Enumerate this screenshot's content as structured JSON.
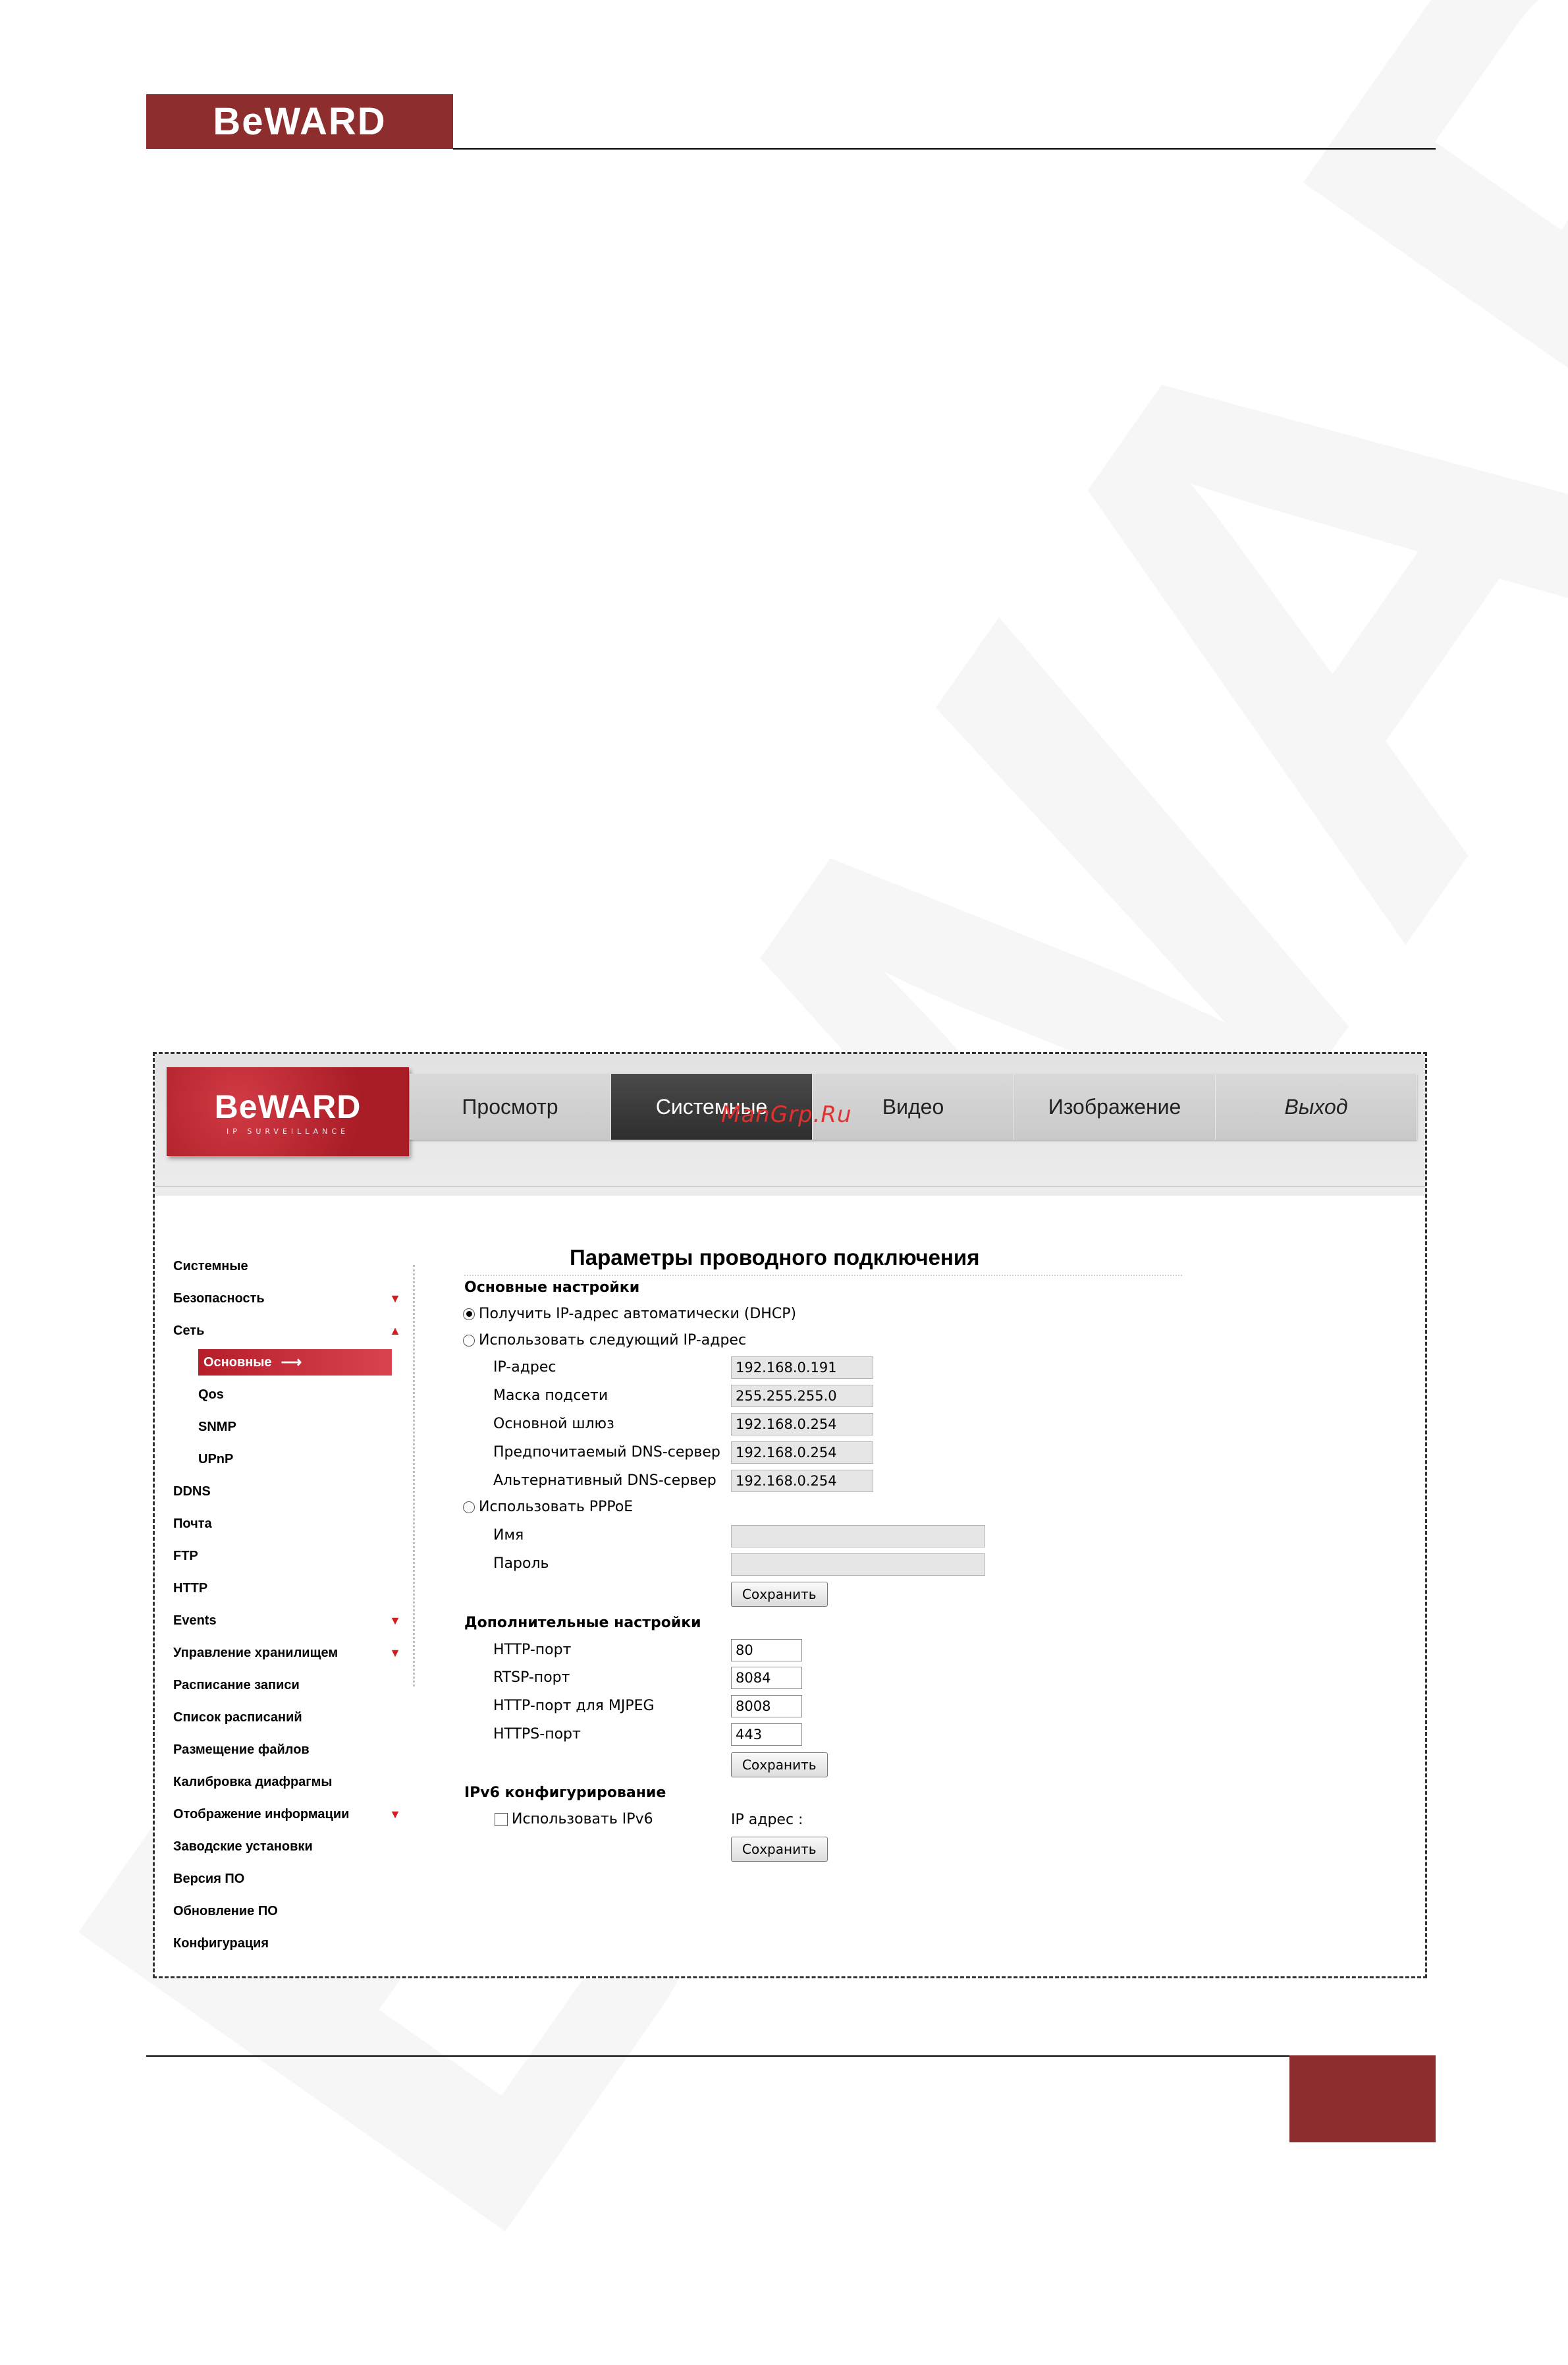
{
  "doc": {
    "logo_text": "BeWARD"
  },
  "camera_ui": {
    "logo_brand": "BeWARD",
    "logo_sub": "IP SURVEILLANCE",
    "overlay_watermark": "ManGrp.Ru",
    "nav": {
      "tabs": [
        "Просмотр",
        "Системные",
        "Видео",
        "Изображение",
        "Выход"
      ],
      "active_index": 1
    },
    "sidebar": {
      "items": [
        {
          "label": "Системные"
        },
        {
          "label": "Безопасность"
        },
        {
          "label": "Сеть"
        },
        {
          "label": "Основные"
        },
        {
          "label": "Qos"
        },
        {
          "label": "SNMP"
        },
        {
          "label": "UPnP"
        },
        {
          "label": "DDNS"
        },
        {
          "label": "Почта"
        },
        {
          "label": "FTP"
        },
        {
          "label": "HTTP"
        },
        {
          "label": "Events"
        },
        {
          "label": "Управление хранилищем"
        },
        {
          "label": "Расписание записи"
        },
        {
          "label": "Список расписаний"
        },
        {
          "label": "Размещение файлов"
        },
        {
          "label": "Калибровка диафрагмы"
        },
        {
          "label": "Отображение информации"
        },
        {
          "label": "Заводские установки"
        },
        {
          "label": "Версия ПО"
        },
        {
          "label": "Обновление ПО"
        },
        {
          "label": "Конфигурация"
        }
      ],
      "active_item": "Основные"
    },
    "content": {
      "title": "Параметры проводного подключения",
      "basic": {
        "heading": "Основные настройки",
        "dhcp_label": "Получить IP-адрес автоматически (DHCP)",
        "dhcp_selected": true,
        "static_label": "Использовать следующий IP-адрес",
        "ip_label": "IP-адрес",
        "ip_value": "192.168.0.191",
        "mask_label": "Маска подсети",
        "mask_value": "255.255.255.0",
        "gateway_label": "Основной шлюз",
        "gateway_value": "192.168.0.254",
        "dns1_label": "Предпочитаемый DNS-сервер",
        "dns1_value": "192.168.0.254",
        "dns2_label": "Альтернативный DNS-сервер",
        "dns2_value": "192.168.0.254",
        "pppoe_label": "Использовать PPPoE",
        "name_label": "Имя",
        "name_value": "",
        "password_label": "Пароль",
        "password_value": "",
        "save_label": "Сохранить"
      },
      "advanced": {
        "heading": "Дополнительные настройки",
        "http_label": "HTTP-порт",
        "http_value": "80",
        "rtsp_label": "RTSP-порт",
        "rtsp_value": "8084",
        "mjpeg_label": "HTTP-порт для MJPEG",
        "mjpeg_value": "8008",
        "https_label": "HTTPS-порт",
        "https_value": "443",
        "save_label": "Сохранить"
      },
      "ipv6": {
        "heading": "IPv6 конфигурирование",
        "use_label": "Использовать IPv6",
        "use_checked": false,
        "ip_label": "IP адрес :",
        "save_label": "Сохранить"
      }
    }
  }
}
